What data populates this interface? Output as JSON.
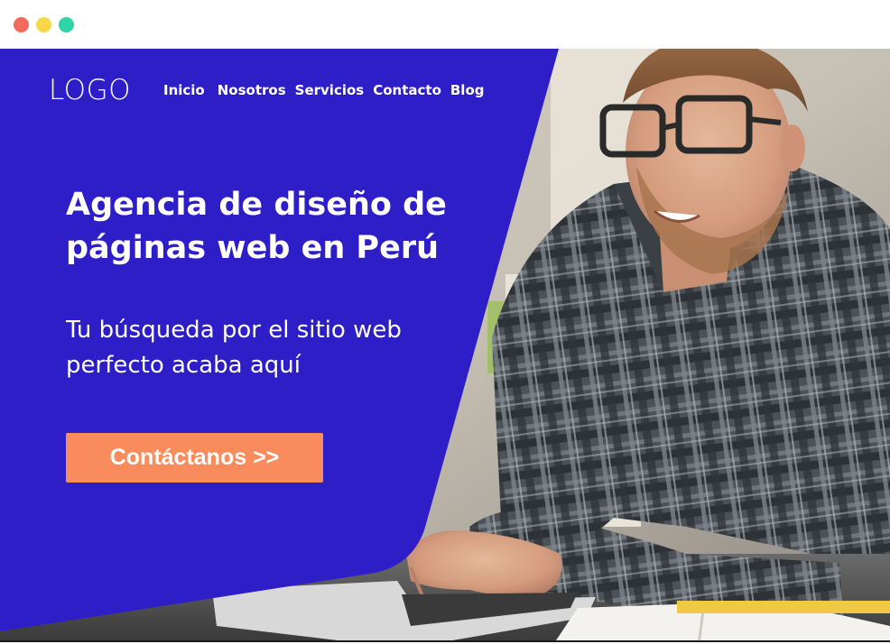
{
  "window_controls": {
    "close_color": "#f26a5b",
    "minimize_color": "#f8d748",
    "maximize_color": "#2dd4a6"
  },
  "brand": {
    "logo_text": "LOGO",
    "panel_color": "#2e1ec7",
    "accent_color": "#f98b5c"
  },
  "nav": {
    "items": [
      {
        "label": "Inicio"
      },
      {
        "label": "Nosotros"
      },
      {
        "label": "Servicios"
      },
      {
        "label": "Contacto"
      },
      {
        "label": "Blog"
      }
    ]
  },
  "hero": {
    "headline": "Agencia de diseño de páginas web en Perú",
    "subtitle": "Tu búsqueda por el sitio web perfecto acaba aquí",
    "cta_label": "Contáctanos >>"
  }
}
